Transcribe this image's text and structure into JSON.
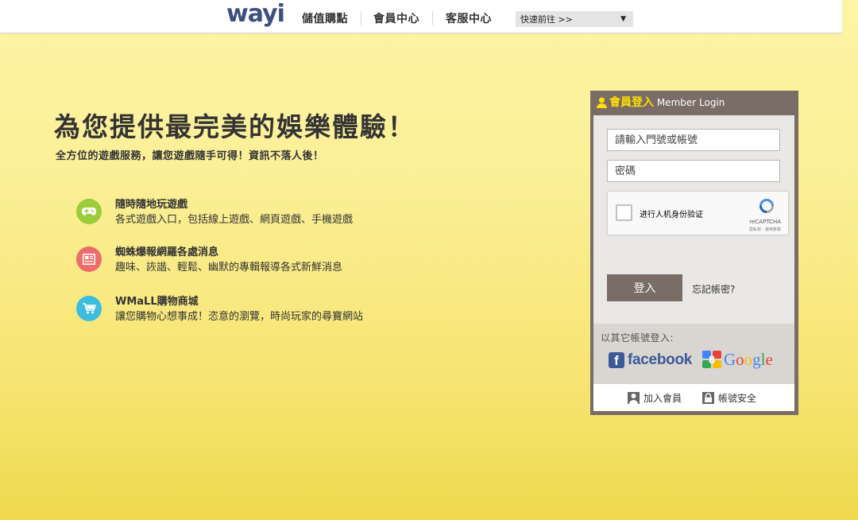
{
  "header": {
    "logo": "wayi",
    "nav": [
      "儲值購點",
      "會員中心",
      "客服中心"
    ],
    "quick_select": {
      "value": "快速前往 >>",
      "arrow": "▼"
    }
  },
  "hero": {
    "title": "為您提供最完美的娛樂體驗！",
    "subtitle": "全方位的遊戲服務，讓您遊戲隨手可得！資訊不落人後！",
    "features": [
      {
        "icon": "gamepad-icon",
        "color": "#9ccb3b",
        "title": "隨時隨地玩遊戲",
        "desc": "各式遊戲入口，包括線上遊戲、網頁遊戲、手機遊戲"
      },
      {
        "icon": "news-icon",
        "color": "#ee6c6c",
        "title": "蜘蛛爆報網羅各處消息",
        "desc": "趣味、詼諧、輕鬆、幽默的專輯報導各式新鮮消息"
      },
      {
        "icon": "cart-icon",
        "color": "#3cbde0",
        "title": "WMaLL購物商城",
        "desc": "讓您購物心想事成！恣意的瀏覽，時尚玩家的尋寶網站"
      }
    ]
  },
  "login": {
    "title_zh": "會員登入",
    "title_en": "Member Login",
    "account_placeholder": "請輸入門號或帳號",
    "password_placeholder": "密碼",
    "captcha": {
      "label": "进行人机身份验证",
      "brand": "reCAPTCHA",
      "terms": "隐私权 - 使用条款"
    },
    "submit_label": "登入",
    "forgot_label": "忘記帳密?",
    "social_label": "以其它帳號登入:",
    "facebook_label": "facebook",
    "google_label": "Google",
    "join_label": "加入會員",
    "security_label": "帳號安全"
  },
  "colors": {
    "box": "#7a6c66",
    "title_yellow": "#ffde00",
    "logo": "#3c4f7d",
    "facebook": "#3b5998"
  }
}
